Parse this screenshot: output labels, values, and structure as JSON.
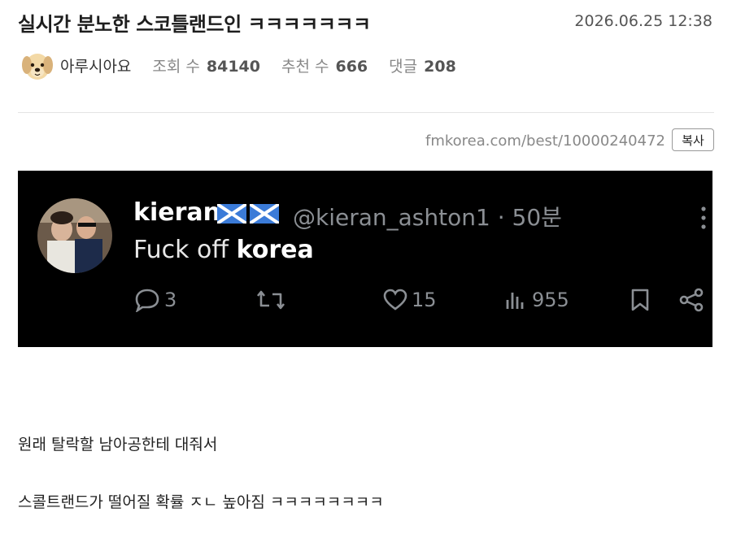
{
  "post": {
    "title": "실시간 분노한 스코틀랜드인 ㅋㅋㅋㅋㅋㅋㅋ",
    "date": "2026.06.25 12:38",
    "author": "아루시아요",
    "views_label": "조회 수",
    "views": "84140",
    "recommend_label": "추천 수",
    "recommend": "666",
    "comments_label": "댓글",
    "comments": "208",
    "url": "fmkorea.com/best/10000240472",
    "copy_label": "복사"
  },
  "tweet": {
    "name": "kieran",
    "handle": "@kieran_ashton1 · 50분",
    "text_prefix": "Fuck off ",
    "text_bold": "korea",
    "replies": "3",
    "likes": "15",
    "views": "955"
  },
  "body": {
    "line1": "원래 탈락할 남아공한테 대줘서",
    "line2": "스콜트랜드가 떨어질 확률 ㅈㄴ 높아짐 ㅋㅋㅋㅋㅋㅋㅋㅋ"
  },
  "colors": {
    "tweet_bg": "#000000",
    "muted": "#8b8f94",
    "flag_blue": "#3b7bd8"
  },
  "icons": [
    "dog-avatar-icon",
    "scotland-flag-icon",
    "more-icon",
    "reply-icon",
    "retweet-icon",
    "like-icon",
    "views-icon",
    "bookmark-icon",
    "share-icon"
  ]
}
